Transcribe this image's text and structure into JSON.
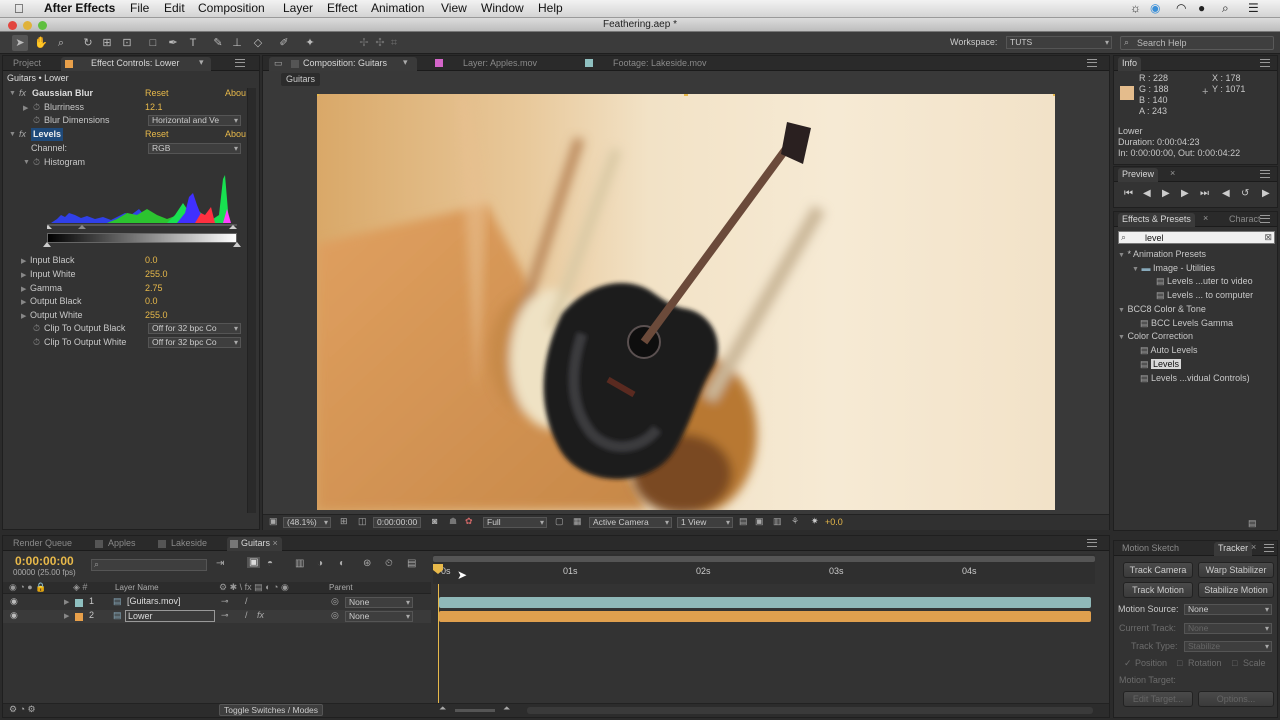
{
  "menubar": {
    "app": "After Effects",
    "items": [
      "File",
      "Edit",
      "Composition",
      "Layer",
      "Effect",
      "Animation",
      "View",
      "Window",
      "Help"
    ]
  },
  "window": {
    "title": "Feathering.aep *"
  },
  "toolbar": {
    "workspace_label": "Workspace:",
    "workspace_value": "TUTS",
    "search_placeholder": "Search Help"
  },
  "left_panel": {
    "tab_project": "Project",
    "tab_effect_controls": "Effect Controls: Lower",
    "breadcrumb": "Guitars • Lower",
    "gaussian": {
      "name": "Gaussian Blur",
      "reset": "Reset",
      "about": "Abou",
      "blurriness_label": "Blurriness",
      "blurriness_value": "12.1",
      "dimensions_label": "Blur Dimensions",
      "dimensions_value": "Horizontal and Ve"
    },
    "levels": {
      "name": "Levels",
      "reset": "Reset",
      "about": "Abou",
      "channel_label": "Channel:",
      "channel_value": "RGB",
      "histogram_label": "Histogram",
      "params": [
        {
          "label": "Input Black",
          "value": "0.0"
        },
        {
          "label": "Input White",
          "value": "255.0"
        },
        {
          "label": "Gamma",
          "value": "2.75"
        },
        {
          "label": "Output Black",
          "value": "0.0"
        },
        {
          "label": "Output White",
          "value": "255.0"
        }
      ],
      "clip_black_label": "Clip To Output Black",
      "clip_black_value": "Off for 32 bpc Co",
      "clip_white_label": "Clip To Output White",
      "clip_white_value": "Off for 32 bpc Co"
    }
  },
  "comp_panel": {
    "tab_comp": "Composition: Guitars",
    "tab_layer": "Layer: Apples.mov",
    "tab_footage": "Footage: Lakeside.mov",
    "sub_tab": "Guitars",
    "zoom": "(48.1%)",
    "timecode": "0:00:00:00",
    "resolution": "Full",
    "camera": "Active Camera",
    "views": "1 View",
    "exposure": "+0.0"
  },
  "info": {
    "tab": "Info",
    "r": "R : 228",
    "g": "G : 188",
    "b": "B : 140",
    "a": "A : 243",
    "x": "X : 178",
    "y": "Y : 1071",
    "swatch_color": "#e4bc8c",
    "layer": "Lower",
    "duration": "Duration: 0:00:04:23",
    "inout": "In: 0:00:00:00, Out: 0:00:04:22"
  },
  "preview": {
    "tab": "Preview"
  },
  "effects_presets": {
    "tab": "Effects & Presets",
    "tab2": "Characte",
    "search_value": "level",
    "tree": [
      {
        "label": "* Animation Presets",
        "level": 0
      },
      {
        "label": "Image - Utilities",
        "level": 1
      },
      {
        "label": "Levels ...uter to video",
        "level": 2
      },
      {
        "label": "Levels ... to computer",
        "level": 2
      },
      {
        "label": "BCC8 Color & Tone",
        "level": 0
      },
      {
        "label": "BCC Levels Gamma",
        "level": 1
      },
      {
        "label": "Color Correction",
        "level": 0
      },
      {
        "label": "Auto Levels",
        "level": 1
      },
      {
        "label": "Levels",
        "level": 1
      },
      {
        "label": "Levels ...vidual Controls)",
        "level": 1
      }
    ]
  },
  "timeline": {
    "tab_render": "Render Queue",
    "tab_apples": "Apples",
    "tab_lakeside": "Lakeside",
    "tab_guitars": "Guitars",
    "timecode": "0:00:00:00",
    "fps": "00000 (25.00 fps)",
    "col_layer_name": "Layer Name",
    "col_parent": "Parent",
    "ruler": [
      "0s",
      "01s",
      "02s",
      "03s",
      "04s"
    ],
    "layers": [
      {
        "num": "1",
        "name": "[Guitars.mov]",
        "parent": "None",
        "color": "#8fc0c0"
      },
      {
        "num": "2",
        "name": "Lower",
        "parent": "None",
        "color": "#e8a04a"
      }
    ],
    "toggle": "Toggle Switches / Modes"
  },
  "tracker": {
    "tab_motion": "Motion Sketch",
    "tab_tracker": "Tracker",
    "track_camera": "Track Camera",
    "warp_stabilizer": "Warp Stabilizer",
    "track_motion": "Track Motion",
    "stabilize_motion": "Stabilize Motion",
    "source_label": "Motion Source:",
    "source_value": "None",
    "current_track_label": "Current Track:",
    "current_track_value": "None",
    "track_type_label": "Track Type:",
    "track_type_value": "Stabilize",
    "position": "Position",
    "rotation": "Rotation",
    "scale": "Scale",
    "target_label": "Motion Target:",
    "edit_target": "Edit Target...",
    "options": "Options..."
  },
  "colors": {
    "label_magenta": "#d465c9",
    "label_teal": "#8fc0c0",
    "label_orange": "#e8a04a",
    "accent_yellow": "#e8b94a"
  }
}
